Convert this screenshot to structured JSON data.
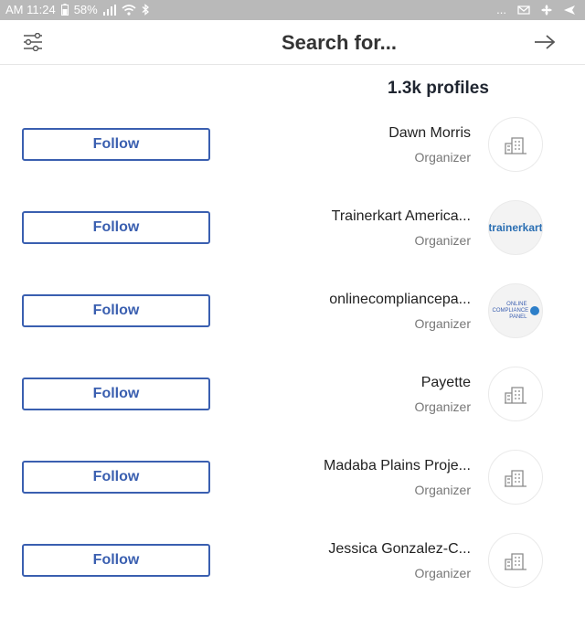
{
  "status_bar": {
    "time": "AM 11:24",
    "battery": "58%",
    "more": "..."
  },
  "header": {
    "title": "Search for...",
    "icons": {
      "back": "arrow-right-icon",
      "filter": "filter-sliders-icon"
    }
  },
  "results": {
    "count_label": "1.3k profiles"
  },
  "profiles": [
    {
      "name": "Dawn Morris",
      "role": "Organizer",
      "follow_label": "Follow",
      "avatar": "building-placeholder-icon"
    },
    {
      "name": "Trainerkart America...",
      "role": "Organizer",
      "follow_label": "Follow",
      "avatar": "trainerkart-logo",
      "logo_text": "trainerkart"
    },
    {
      "name": "onlinecompliancepa...",
      "role": "Organizer",
      "follow_label": "Follow",
      "avatar": "onlinecompliancepanel-logo",
      "logo_text": "ONLINE COMPLIANCE PANEL"
    },
    {
      "name": "Payette",
      "role": "Organizer",
      "follow_label": "Follow",
      "avatar": "building-placeholder-icon"
    },
    {
      "name": "Madaba Plains Proje...",
      "role": "Organizer",
      "follow_label": "Follow",
      "avatar": "building-placeholder-icon"
    },
    {
      "name": "Jessica Gonzalez-C...",
      "role": "Organizer",
      "follow_label": "Follow",
      "avatar": "building-placeholder-icon"
    }
  ],
  "colors": {
    "accent": "#3a5fb0",
    "status_bar": "#b9b9b9",
    "muted_text": "#777777"
  }
}
